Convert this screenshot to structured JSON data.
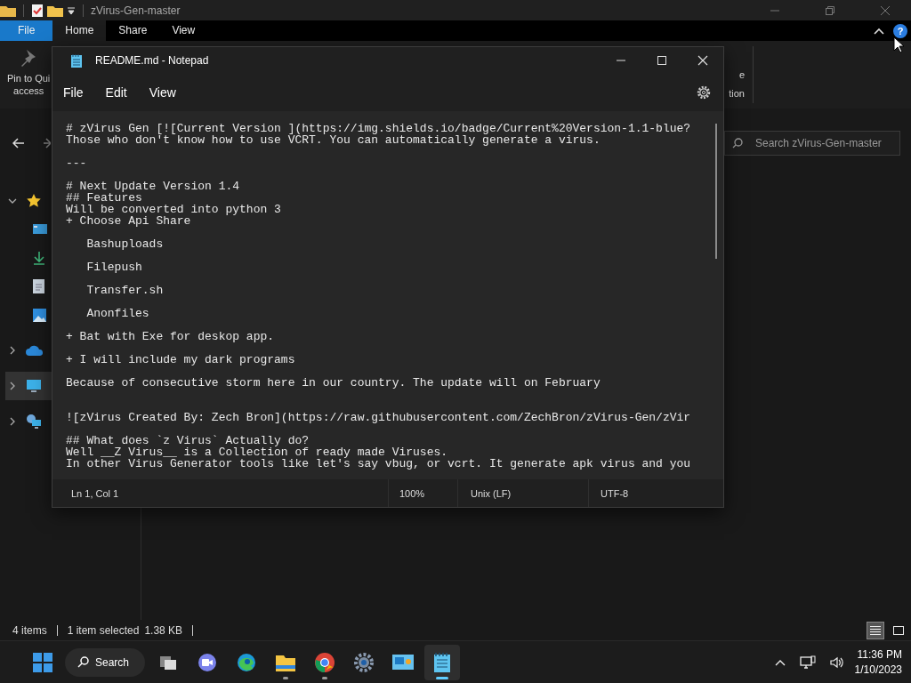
{
  "explorer": {
    "title": "zVirus-Gen-master",
    "ribbon_tabs": [
      {
        "label": "File",
        "kind": "file",
        "selected": false
      },
      {
        "label": "Home",
        "kind": "tab",
        "selected": true
      },
      {
        "label": "Share",
        "kind": "tab",
        "selected": false
      },
      {
        "label": "View",
        "kind": "tab",
        "selected": false
      }
    ],
    "help_glyph": "?",
    "ribbon_left": [
      "Pin to Qui",
      "access"
    ],
    "ribbon_right": [
      "e",
      "tion"
    ],
    "search": {
      "placeholder": "Search zVirus-Gen-master"
    },
    "nav_items": [
      {
        "kind": "star",
        "expanded": true,
        "selected": false,
        "children": [
          {
            "kind": "desktop",
            "selected": false
          },
          {
            "kind": "download",
            "selected": false
          },
          {
            "kind": "document",
            "selected": false
          },
          {
            "kind": "pictures",
            "selected": false
          }
        ]
      },
      {
        "kind": "cloud",
        "expanded": false,
        "selected": false
      },
      {
        "kind": "pc",
        "expanded": false,
        "selected": true
      },
      {
        "kind": "network",
        "expanded": false,
        "selected": false
      }
    ],
    "status": {
      "items": "4 items",
      "selection": "1 item selected",
      "size": "1.38 KB"
    },
    "view_buttons": [
      {
        "kind": "details",
        "selected": true
      },
      {
        "kind": "tiles",
        "selected": false
      }
    ]
  },
  "notepad": {
    "title": "README.md - Notepad",
    "menu": [
      "File",
      "Edit",
      "View"
    ],
    "lines": [
      {
        "kind": "text",
        "text": "# zVirus Gen [![Current Version ](https://img.shields.io/badge/Current%20Version-1.1-blue?"
      },
      {
        "kind": "text",
        "text": "Those who don't know how to use VCRT. You can automatically generate a virus."
      },
      {
        "kind": "blank"
      },
      {
        "kind": "text",
        "text": "---"
      },
      {
        "kind": "blank"
      },
      {
        "kind": "text",
        "text": "# Next Update Version 1.4"
      },
      {
        "kind": "text",
        "text": "## Features"
      },
      {
        "kind": "text",
        "text": "Will be converted into python 3"
      },
      {
        "kind": "text",
        "text": "+ Choose Api Share"
      },
      {
        "kind": "blank"
      },
      {
        "kind": "text",
        "text": "   Bashuploads"
      },
      {
        "kind": "blank"
      },
      {
        "kind": "text",
        "text": "   Filepush"
      },
      {
        "kind": "blank"
      },
      {
        "kind": "text",
        "text": "   Transfer.sh"
      },
      {
        "kind": "blank"
      },
      {
        "kind": "text",
        "text": "   Anonfiles"
      },
      {
        "kind": "blank"
      },
      {
        "kind": "text",
        "text": "+ Bat with Exe for deskop app."
      },
      {
        "kind": "blank"
      },
      {
        "kind": "text",
        "text": "+ I will include my dark programs"
      },
      {
        "kind": "blank"
      },
      {
        "kind": "text",
        "text": "Because of consecutive storm here in our country. The update will on February"
      },
      {
        "kind": "blank"
      },
      {
        "kind": "blank"
      },
      {
        "kind": "text",
        "text": "![zVirus Created By: Zech Bron](https://raw.githubusercontent.com/ZechBron/zVirus-Gen/zVir"
      },
      {
        "kind": "blank"
      },
      {
        "kind": "text",
        "text": "## What does `z Virus` Actually do?"
      },
      {
        "kind": "text",
        "text": "Well __Z Virus__ is a Collection of ready made Viruses."
      },
      {
        "kind": "text",
        "text": "In other Virus Generator tools like let's say vbug, or vcrt. It generate apk virus and you"
      }
    ],
    "status": [
      "Ln 1, Col 1",
      "100%",
      "Unix (LF)",
      "UTF-8"
    ]
  },
  "taskbar": {
    "search_label": "Search",
    "apps": [
      {
        "kind": "taskview",
        "running": false,
        "selected": false
      },
      {
        "kind": "chat",
        "running": false,
        "selected": false
      },
      {
        "kind": "edge",
        "running": false,
        "selected": false
      },
      {
        "kind": "folder",
        "running": true,
        "selected": false
      },
      {
        "kind": "chrome",
        "running": true,
        "selected": false
      },
      {
        "kind": "settings",
        "running": false,
        "selected": false
      },
      {
        "kind": "control",
        "running": false,
        "selected": false
      },
      {
        "kind": "notepad",
        "running": true,
        "selected": true
      }
    ],
    "time": "11:36 PM",
    "date": "1/10/2023"
  }
}
